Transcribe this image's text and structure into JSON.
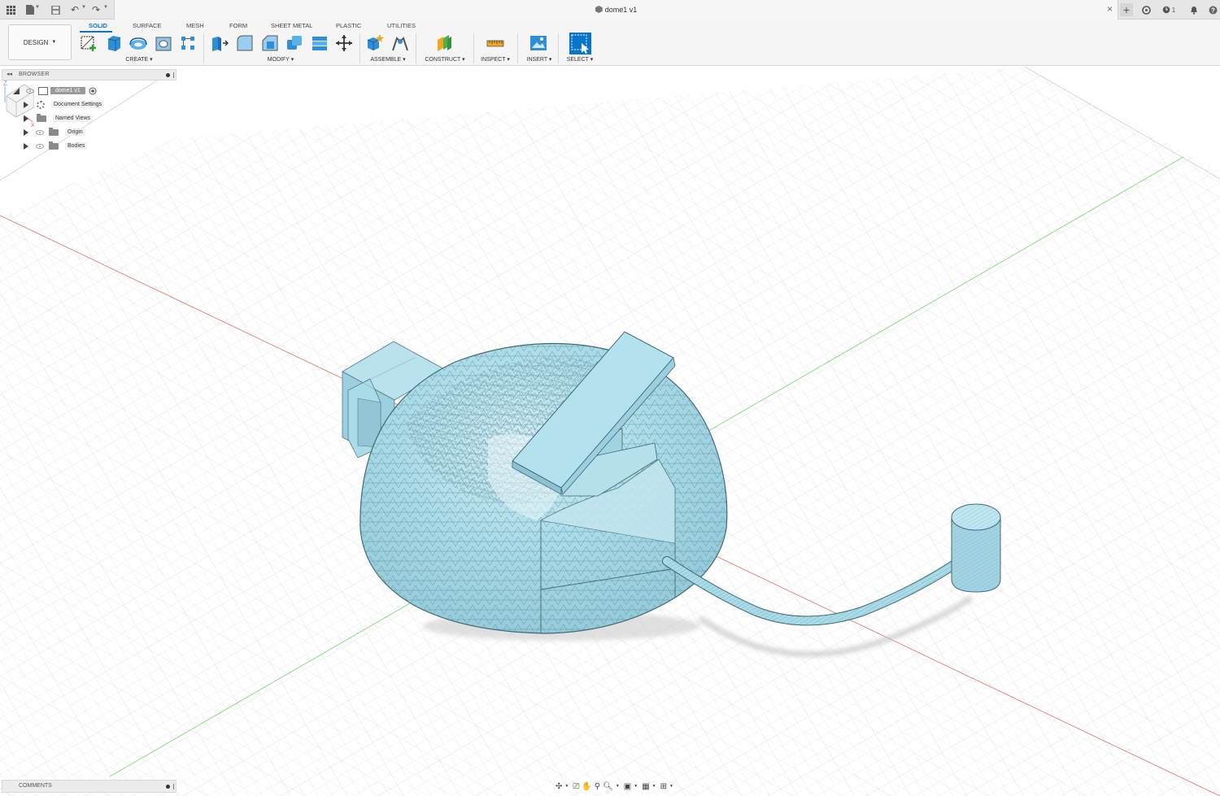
{
  "window": {
    "document_title": "dome1 v1",
    "notifications_count": "1"
  },
  "toolbar": {
    "workspace_label": "DESIGN",
    "tabs": [
      {
        "label": "SOLID",
        "active": true
      },
      {
        "label": "SURFACE",
        "active": false
      },
      {
        "label": "MESH",
        "active": false
      },
      {
        "label": "FORM",
        "active": false
      },
      {
        "label": "SHEET METAL",
        "active": false
      },
      {
        "label": "PLASTIC",
        "active": false
      },
      {
        "label": "UTILITIES",
        "active": false
      }
    ],
    "groups": {
      "create": "CREATE",
      "modify": "MODIFY",
      "assemble": "ASSEMBLE",
      "construct": "CONSTRUCT",
      "inspect": "INSPECT",
      "insert": "INSERT",
      "select": "SELECT"
    }
  },
  "browser": {
    "title": "BROWSER",
    "root": "dome1 v1",
    "items": [
      {
        "label": "Document Settings",
        "icon": "gear-icon"
      },
      {
        "label": "Named Views",
        "icon": "folder-icon"
      },
      {
        "label": "Origin",
        "icon": "folder-icon"
      },
      {
        "label": "Bodies",
        "icon": "folder-icon"
      }
    ]
  },
  "comments": {
    "title": "COMMENTS"
  },
  "colors": {
    "accent": "#0a74c9",
    "model_fill": "#a9dbe8",
    "model_edge": "#4f7c88",
    "axis_red": "#e05a5a",
    "axis_green": "#6ccf63"
  }
}
